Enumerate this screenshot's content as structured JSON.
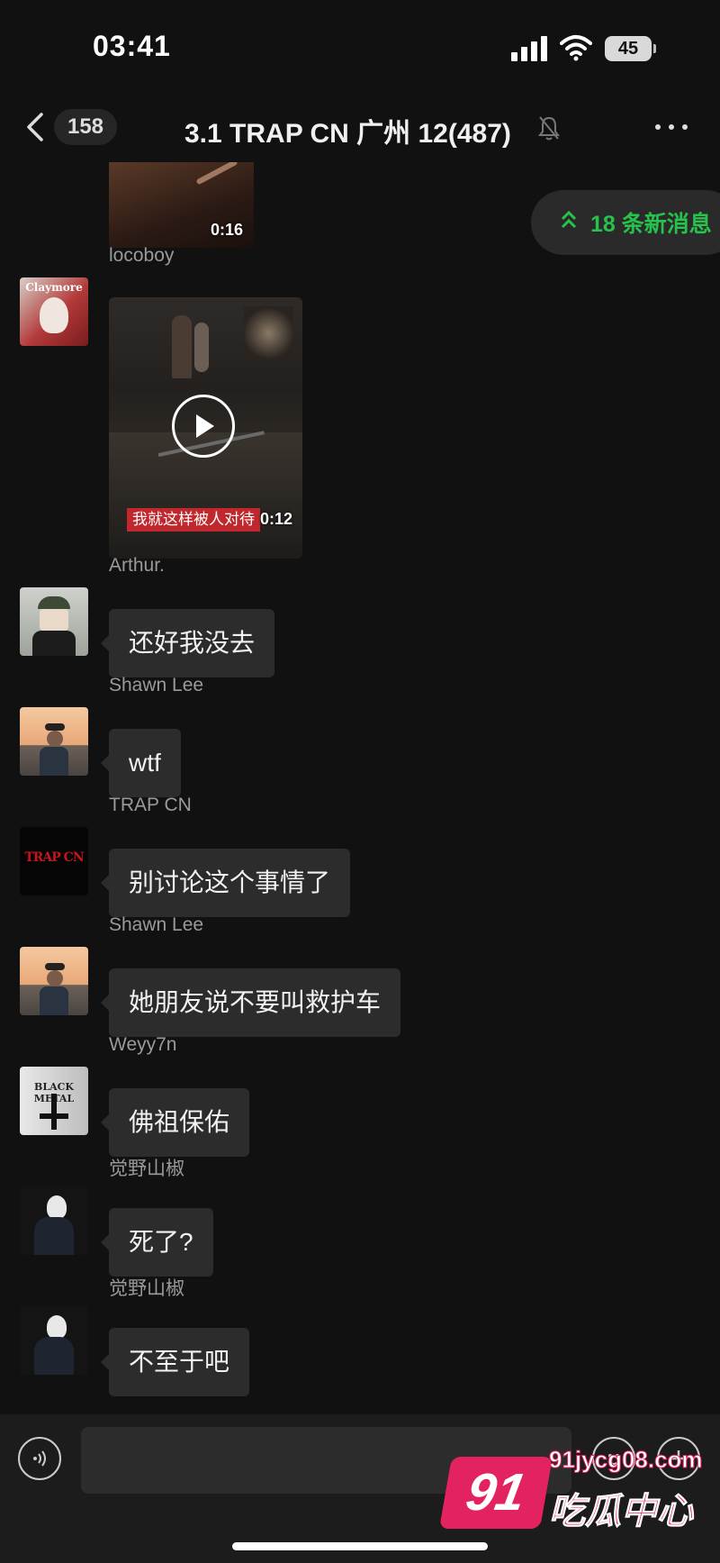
{
  "status_bar": {
    "time": "03:41",
    "battery": "45"
  },
  "nav": {
    "back_count": "158",
    "title": "3.1 TRAP CN 广州 12(487)"
  },
  "new_messages": {
    "label": "18 条新消息"
  },
  "top_video": {
    "duration": "0:16"
  },
  "messages": [
    {
      "sender": "locoboy",
      "type": "video",
      "caption": "我就这样被人对待",
      "duration": "0:12"
    },
    {
      "sender": "Arthur.",
      "text": "还好我没去"
    },
    {
      "sender": "Shawn Lee",
      "text": "wtf"
    },
    {
      "sender": "TRAP CN",
      "text": "别讨论这个事情了"
    },
    {
      "sender": "Shawn Lee",
      "text": "她朋友说不要叫救护车"
    },
    {
      "sender": "Weyy7n",
      "text": "佛祖保佑"
    },
    {
      "sender": "觉野山椒",
      "text": "死了?"
    },
    {
      "sender": "觉野山椒",
      "text": "不至于吧"
    }
  ],
  "avatars": {
    "locoboy_text": "Claymore",
    "trapcn_text": "TRAP CN",
    "weyy7n_text": "BLACK METAL"
  },
  "input": {
    "value": "",
    "placeholder": ""
  },
  "watermark": {
    "number": "91",
    "url": "91jycg08.com",
    "name": "吃瓜中心"
  },
  "colors": {
    "background": "#111111",
    "bubble": "#2c2c2c",
    "accent_green": "#27c24c",
    "watermark_pink": "#e3235f"
  }
}
